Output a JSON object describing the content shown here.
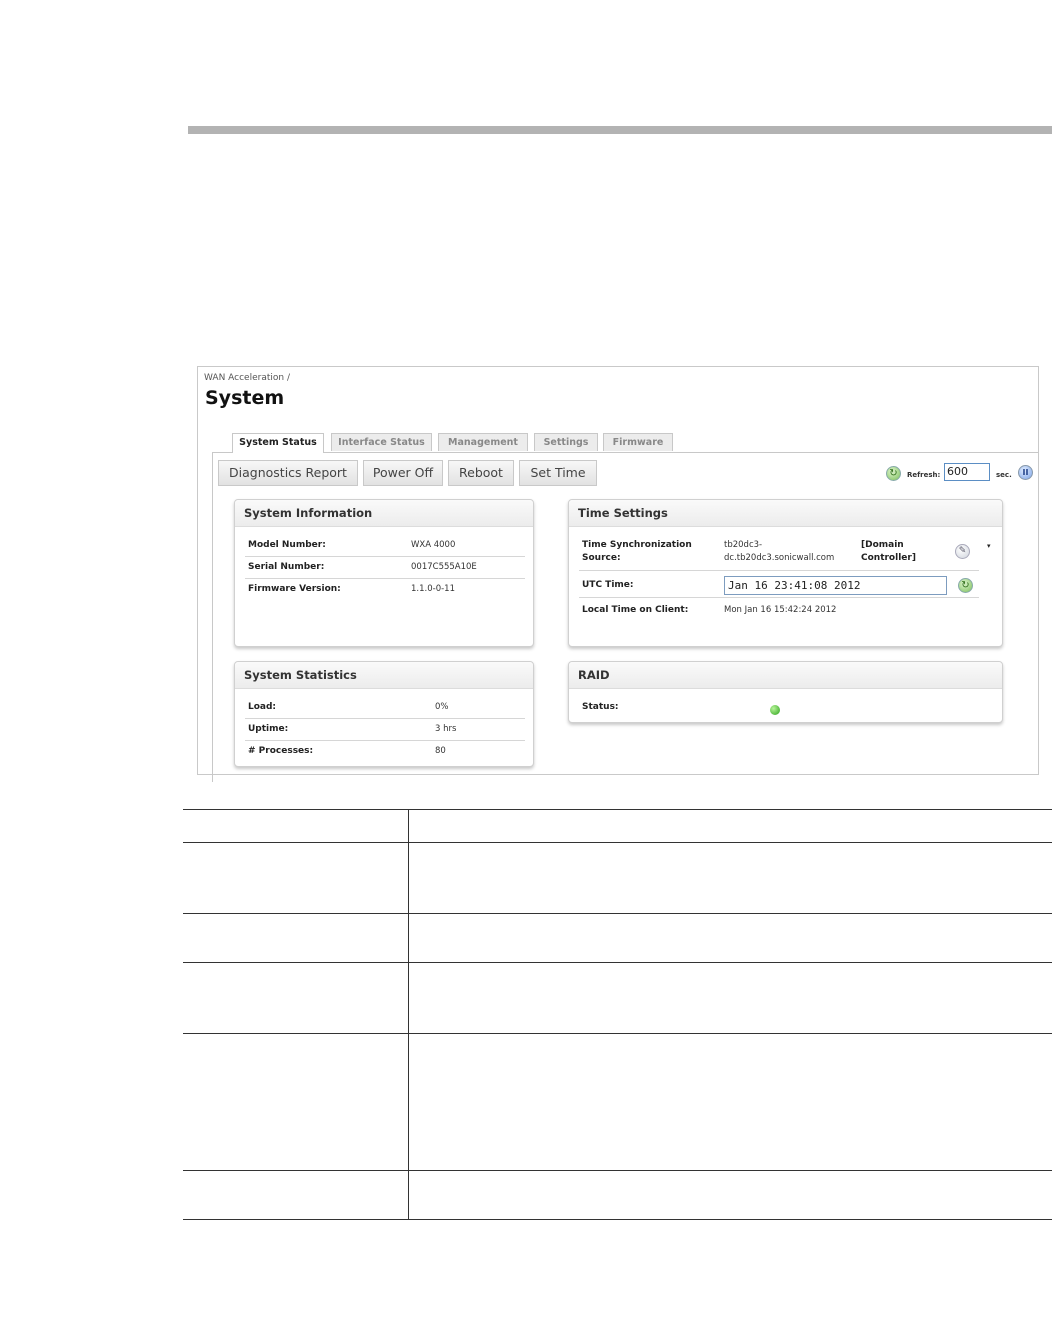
{
  "breadcrumb": "WAN Acceleration /",
  "page_title": "System",
  "tabs": [
    {
      "label": "System Status",
      "active": true
    },
    {
      "label": "Interface Status",
      "active": false
    },
    {
      "label": "Management",
      "active": false
    },
    {
      "label": "Settings",
      "active": false
    },
    {
      "label": "Firmware",
      "active": false
    }
  ],
  "toolbar": {
    "buttons": [
      "Diagnostics Report",
      "Power Off",
      "Reboot",
      "Set Time"
    ],
    "refresh_label": "Refresh:",
    "refresh_value": "600",
    "refresh_unit": "sec."
  },
  "system_information": {
    "title": "System Information",
    "rows": [
      {
        "label": "Model Number:",
        "value": "WXA 4000"
      },
      {
        "label": "Serial Number:",
        "value": "0017C555A10E"
      },
      {
        "label": "Firmware Version:",
        "value": "1.1.0-0-11"
      }
    ]
  },
  "time_settings": {
    "title": "Time Settings",
    "sync_label_1": "Time Synchronization",
    "sync_label_2": "Source:",
    "sync_value_1": "tb20dc3-",
    "sync_value_2": "dc.tb20dc3.sonicwall.com",
    "sync_type_1": "[Domain",
    "sync_type_2": "Controller]",
    "utc_label": "UTC Time:",
    "utc_value": "Jan 16 23:41:08 2012",
    "local_label": "Local Time on Client:",
    "local_value": "Mon Jan 16 15:42:24 2012"
  },
  "system_statistics": {
    "title": "System Statistics",
    "rows": [
      {
        "label": "Load:",
        "value": "0%"
      },
      {
        "label": "Uptime:",
        "value": "3 hrs"
      },
      {
        "label": "# Processes:",
        "value": "80"
      }
    ]
  },
  "raid": {
    "title": "RAID",
    "status_label": "Status:",
    "status_color": "#2aa01a"
  }
}
